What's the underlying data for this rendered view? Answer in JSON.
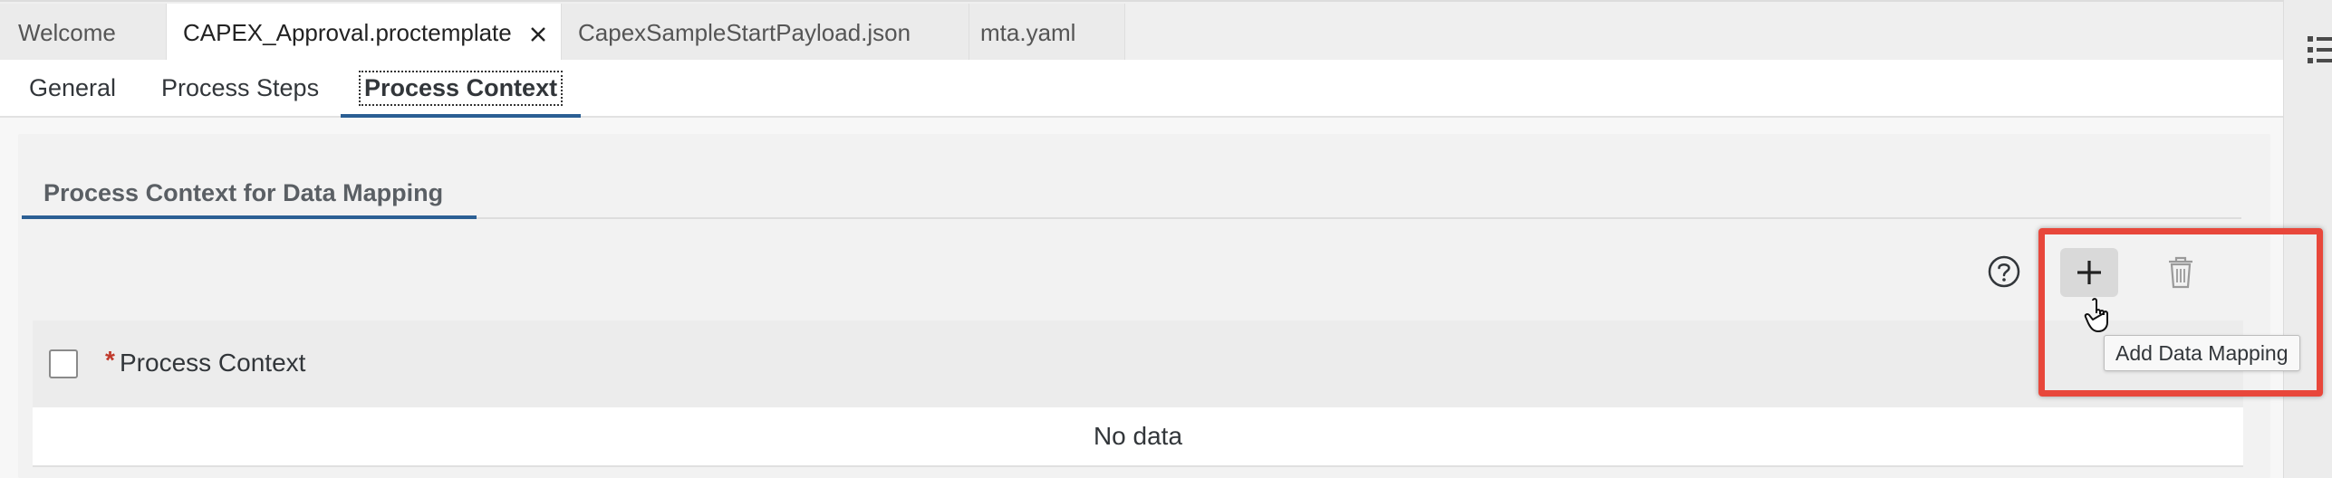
{
  "editor_tabs": [
    {
      "label": "Welcome",
      "active": false
    },
    {
      "label": "CAPEX_Approval.proctemplate",
      "active": true
    },
    {
      "label": "CapexSampleStartPayload.json",
      "active": false
    },
    {
      "label": "mta.yaml",
      "active": false
    }
  ],
  "sub_tabs": [
    {
      "label": "General"
    },
    {
      "label": "Process Steps"
    },
    {
      "label": "Process Context"
    }
  ],
  "section": {
    "title": "Process Context for Data Mapping"
  },
  "toolbar": {
    "help_icon": "help-circle-icon",
    "add_icon": "plus-icon",
    "delete_icon": "trash-icon",
    "tooltip": "Add Data Mapping"
  },
  "table": {
    "required_marker": "*",
    "column_header": "Process Context",
    "empty_text": "No data"
  },
  "colors": {
    "accent": "#2b5f94",
    "highlight": "#e8473b",
    "required": "#c0392b"
  }
}
